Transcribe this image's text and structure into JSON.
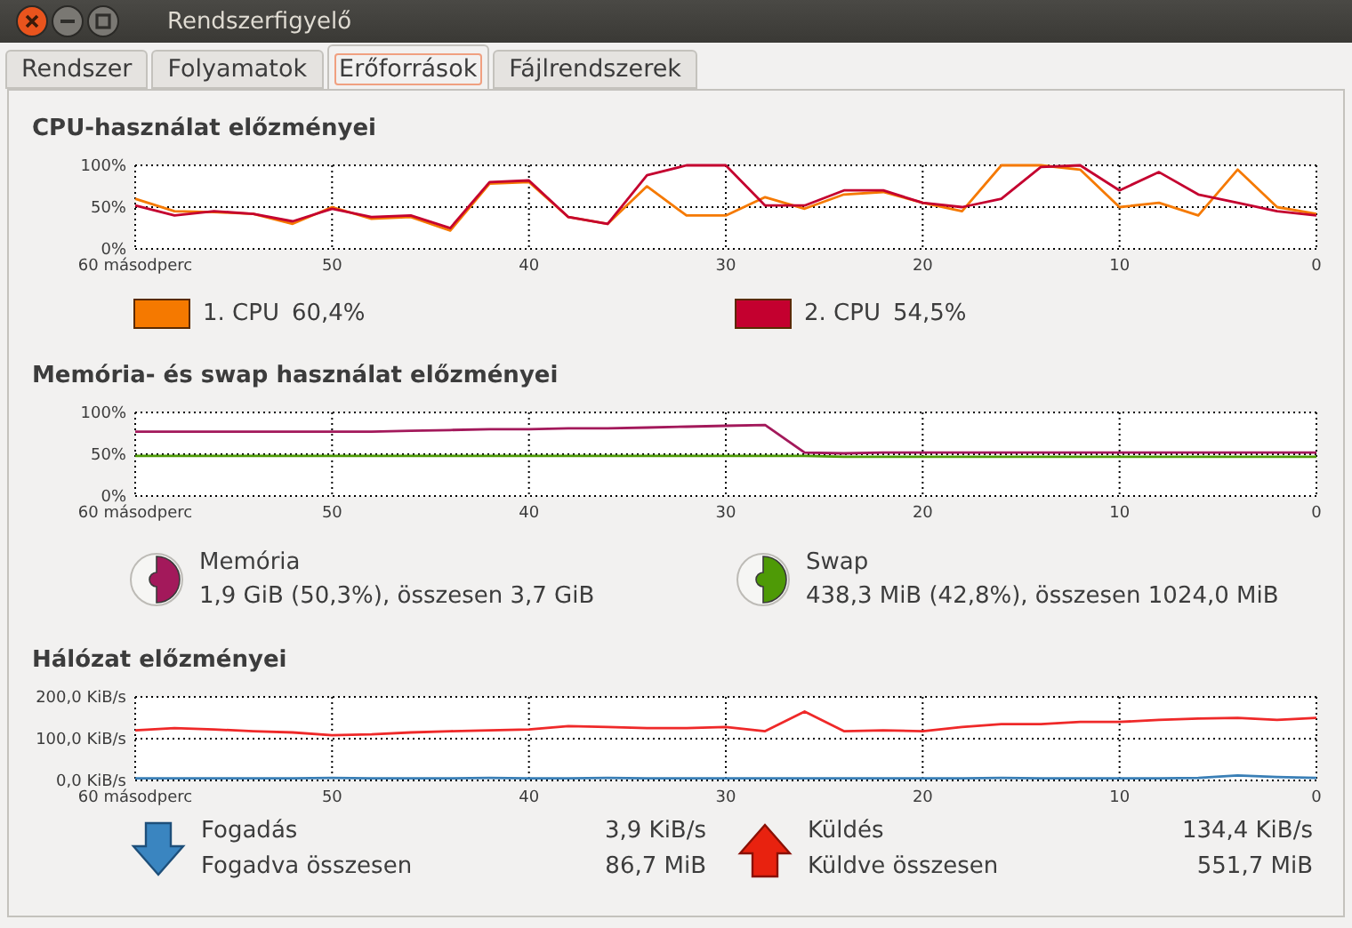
{
  "window": {
    "title": "Rendszerfigyelő"
  },
  "tabs": [
    {
      "label": "Rendszer",
      "selected": false
    },
    {
      "label": "Folyamatok",
      "selected": false
    },
    {
      "label": "Erőforrások",
      "selected": true
    },
    {
      "label": "Fájlrendszerek",
      "selected": false
    }
  ],
  "cpu": {
    "title": "CPU-használat előzményei",
    "chart_data": {
      "type": "line",
      "x": [
        60,
        58,
        56,
        54,
        52,
        50,
        48,
        46,
        44,
        42,
        40,
        38,
        36,
        34,
        32,
        30,
        28,
        26,
        24,
        22,
        20,
        18,
        16,
        14,
        12,
        10,
        8,
        6,
        4,
        2,
        0
      ],
      "xlim": [
        60,
        0
      ],
      "ylim": [
        0,
        100
      ],
      "grid": true,
      "xticks": [
        {
          "value": 60,
          "label": "60 másodperc"
        },
        {
          "value": 50,
          "label": "50"
        },
        {
          "value": 40,
          "label": "40"
        },
        {
          "value": 30,
          "label": "30"
        },
        {
          "value": 20,
          "label": "20"
        },
        {
          "value": 10,
          "label": "10"
        },
        {
          "value": 0,
          "label": "0"
        }
      ],
      "yticks": [
        {
          "value": 0,
          "label": "0%"
        },
        {
          "value": 50,
          "label": "50%"
        },
        {
          "value": 100,
          "label": "100%"
        }
      ],
      "series": [
        {
          "color": "#f57900",
          "values": [
            60,
            45,
            44,
            42,
            30,
            50,
            36,
            38,
            22,
            78,
            80,
            38,
            30,
            75,
            40,
            40,
            62,
            48,
            65,
            68,
            55,
            45,
            100,
            100,
            95,
            50,
            55,
            40,
            95,
            50,
            42
          ]
        },
        {
          "color": "#c4002f",
          "values": [
            52,
            40,
            45,
            42,
            33,
            48,
            38,
            40,
            25,
            80,
            82,
            38,
            30,
            88,
            100,
            100,
            52,
            52,
            70,
            70,
            55,
            50,
            60,
            98,
            100,
            70,
            92,
            65,
            55,
            45,
            40
          ]
        }
      ]
    },
    "legend": [
      {
        "label": "1. CPU",
        "value": "60,4%",
        "color": "#f57900"
      },
      {
        "label": "2. CPU",
        "value": "54,5%",
        "color": "#c4002f"
      }
    ]
  },
  "memory": {
    "title": "Memória- és swap használat előzményei",
    "chart_data": {
      "type": "line",
      "x": [
        60,
        58,
        56,
        54,
        52,
        50,
        48,
        46,
        44,
        42,
        40,
        38,
        36,
        34,
        32,
        30,
        28,
        26,
        24,
        22,
        20,
        18,
        16,
        14,
        12,
        10,
        8,
        6,
        4,
        2,
        0
      ],
      "xlim": [
        60,
        0
      ],
      "ylim": [
        0,
        100
      ],
      "grid": true,
      "xticks": [
        {
          "value": 60,
          "label": "60 másodperc"
        },
        {
          "value": 50,
          "label": "50"
        },
        {
          "value": 40,
          "label": "40"
        },
        {
          "value": 30,
          "label": "30"
        },
        {
          "value": 20,
          "label": "20"
        },
        {
          "value": 10,
          "label": "10"
        },
        {
          "value": 0,
          "label": "0"
        }
      ],
      "yticks": [
        {
          "value": 0,
          "label": "0%"
        },
        {
          "value": 50,
          "label": "50%"
        },
        {
          "value": 100,
          "label": "100%"
        }
      ],
      "series": [
        {
          "color": "#a3195b",
          "values": [
            77,
            77,
            77,
            77,
            77,
            77,
            77,
            78,
            79,
            80,
            80,
            81,
            81,
            82,
            83,
            84,
            85,
            52,
            51,
            52,
            52,
            52,
            52,
            52,
            52,
            52,
            52,
            52,
            52,
            52,
            52
          ]
        },
        {
          "color": "#4e9a06",
          "values": [
            48,
            48,
            48,
            48,
            48,
            48,
            48,
            48,
            48,
            48,
            48,
            48,
            48,
            48,
            48,
            48,
            48,
            48,
            47,
            47,
            47,
            47,
            47,
            47,
            47,
            47,
            47,
            47,
            47,
            47,
            47
          ]
        }
      ]
    },
    "legend": [
      {
        "label": "Memória",
        "detail": "1,9 GiB (50,3%), összesen 3,7 GiB",
        "color": "#a3195b"
      },
      {
        "label": "Swap",
        "detail": "438,3 MiB (42,8%), összesen 1024,0 MiB",
        "color": "#4e9a06"
      }
    ]
  },
  "network": {
    "title": "Hálózat előzményei",
    "chart_data": {
      "type": "line",
      "x": [
        60,
        58,
        56,
        54,
        52,
        50,
        48,
        46,
        44,
        42,
        40,
        38,
        36,
        34,
        32,
        30,
        28,
        26,
        24,
        22,
        20,
        18,
        16,
        14,
        12,
        10,
        8,
        6,
        4,
        2,
        0
      ],
      "xlim": [
        60,
        0
      ],
      "ylim": [
        0,
        200
      ],
      "grid": true,
      "xticks": [
        {
          "value": 60,
          "label": "60 másodperc"
        },
        {
          "value": 50,
          "label": "50"
        },
        {
          "value": 40,
          "label": "40"
        },
        {
          "value": 30,
          "label": "30"
        },
        {
          "value": 20,
          "label": "20"
        },
        {
          "value": 10,
          "label": "10"
        },
        {
          "value": 0,
          "label": "0"
        }
      ],
      "yticks": [
        {
          "value": 0,
          "label": "0,0 KiB/s"
        },
        {
          "value": 100,
          "label": "100,0 KiB/s"
        },
        {
          "value": 200,
          "label": "200,0 KiB/s"
        }
      ],
      "series": [
        {
          "color": "#3a7fb6",
          "values": [
            5,
            5,
            5,
            5,
            5,
            6,
            5,
            5,
            5,
            6,
            5,
            5,
            6,
            5,
            5,
            5,
            5,
            5,
            5,
            5,
            5,
            5,
            6,
            5,
            5,
            5,
            5,
            6,
            12,
            8,
            6
          ]
        },
        {
          "color": "#ef2929",
          "values": [
            120,
            125,
            122,
            118,
            115,
            108,
            110,
            115,
            118,
            120,
            122,
            130,
            128,
            125,
            125,
            128,
            118,
            165,
            118,
            120,
            118,
            128,
            135,
            135,
            140,
            140,
            145,
            148,
            150,
            145,
            150
          ]
        }
      ]
    },
    "legend": [
      {
        "kind": "receive",
        "rows": [
          {
            "label": "Fogadás",
            "value": "3,9 KiB/s"
          },
          {
            "label": "Fogadva összesen",
            "value": "86,7 MiB"
          }
        ]
      },
      {
        "kind": "send",
        "rows": [
          {
            "label": "Küldés",
            "value": "134,4 KiB/s"
          },
          {
            "label": "Küldve összesen",
            "value": "551,7 MiB"
          }
        ]
      }
    ]
  }
}
